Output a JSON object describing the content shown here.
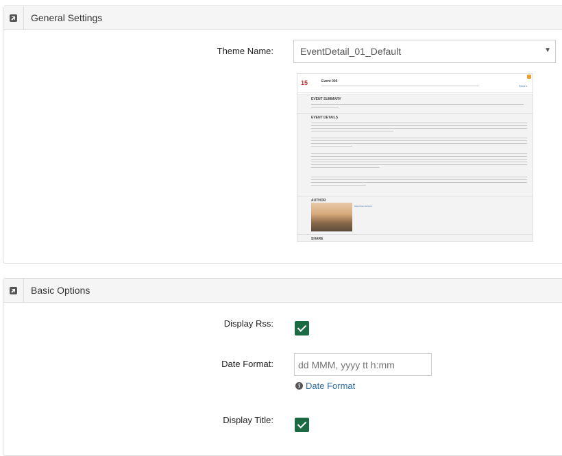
{
  "general_settings": {
    "title": "General Settings",
    "theme_name_label": "Theme Name:",
    "theme_name_value": "EventDetail_01_Default",
    "preview": {
      "date_day": "15",
      "event_title": "Event 005",
      "return_label": "Return",
      "sections": [
        "EVENT SUMMARY",
        "EVENT DETAILS",
        "AUTHOR",
        "SHARE"
      ],
      "author_link": "SuperUser Account"
    }
  },
  "basic_options": {
    "title": "Basic Options",
    "display_rss_label": "Display Rss:",
    "display_rss_checked": true,
    "date_format_label": "Date Format:",
    "date_format_placeholder": "dd MMM, yyyy tt h:mm",
    "date_format_help": "Date Format",
    "display_title_label": "Display Title:",
    "display_title_checked": true
  },
  "colors": {
    "checkbox": "#1c6a44",
    "link": "#2e6da4",
    "header_bg": "#f5f5f5"
  }
}
